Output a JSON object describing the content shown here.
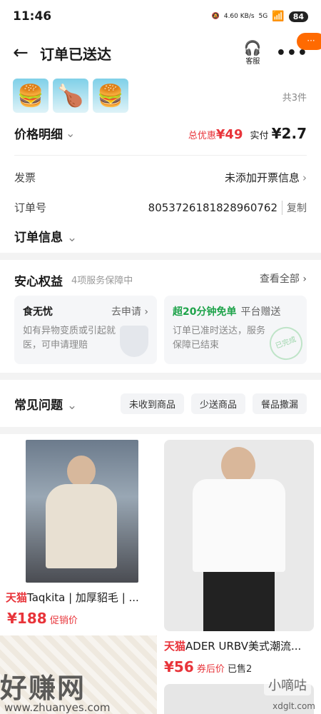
{
  "status": {
    "time": "11:46",
    "net": "4.60 KB/s",
    "signal": "5G",
    "battery": "84"
  },
  "header": {
    "title": "订单已送达",
    "service_label": "客服",
    "badge": "···"
  },
  "order": {
    "count": "共3件",
    "price_label": "价格明细",
    "discount_prefix": "总优惠",
    "discount": "¥49",
    "paid_prefix": "实付",
    "paid": "¥2.7",
    "invoice_label": "发票",
    "invoice_value": "未添加开票信息",
    "order_no_label": "订单号",
    "order_no": "8053726181828960762",
    "copy": "复制",
    "info_label": "订单信息"
  },
  "rights": {
    "title": "安心权益",
    "subtitle": "4项服务保障中",
    "view_all": "查看全部",
    "box1": {
      "title": "食无忧",
      "action": "去申请",
      "desc": "如有异物变质或引起就医，可申请理赔"
    },
    "box2": {
      "title_green": "超20分钟免单",
      "action": "平台赠送",
      "desc": "订单已准时送达，服务保障已结束",
      "stamp": "已完成"
    }
  },
  "faq": {
    "title": "常见问题",
    "tags": [
      "未收到商品",
      "少送商品",
      "餐品撒漏"
    ]
  },
  "products": [
    {
      "brand": "天猫",
      "title": "Taqkita | 加厚貂毛 | ...",
      "price": "¥188",
      "note": "促销价"
    },
    {
      "brand": "天猫",
      "title": "ADER URBV美式潮流...",
      "price": "¥56",
      "note": "券后价",
      "sold": "已售2"
    }
  ],
  "watermark": {
    "text": "好赚网",
    "url": "www.zhuanyes.com",
    "right": "小嘀咕",
    "right_url": "xdglt.com"
  }
}
